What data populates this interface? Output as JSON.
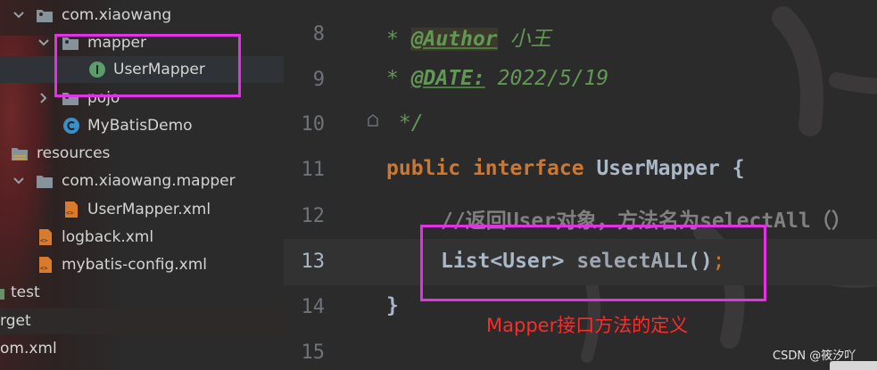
{
  "project_tree": {
    "items": [
      {
        "label": "com.xiaowang",
        "icon": "package-folder-icon",
        "expanded": true
      },
      {
        "label": "mapper",
        "icon": "package-folder-icon",
        "expanded": true
      },
      {
        "label": "UserMapper",
        "icon": "interface-icon",
        "selected": true
      },
      {
        "label": "pojo",
        "icon": "package-folder-icon",
        "expanded": false
      },
      {
        "label": "MyBatisDemo",
        "icon": "class-icon"
      },
      {
        "label": "resources",
        "icon": "resources-folder-icon"
      },
      {
        "label": "com.xiaowang.mapper",
        "icon": "folder-icon",
        "expanded": true
      },
      {
        "label": "UserMapper.xml",
        "icon": "xml-file-icon"
      },
      {
        "label": "logback.xml",
        "icon": "xml-file-icon"
      },
      {
        "label": "mybatis-config.xml",
        "icon": "xml-file-icon"
      },
      {
        "label": "test",
        "icon": "folder-icon"
      },
      {
        "label": "rget",
        "icon": "folder-icon"
      },
      {
        "label": "om.xml",
        "icon": "maven-file-icon"
      }
    ]
  },
  "editor": {
    "line_numbers": [
      "8",
      "9",
      "10",
      "11",
      "12",
      "13",
      "14",
      "15"
    ],
    "current_line": "13",
    "lines": {
      "l8": {
        "star": "* ",
        "tag": "@Author",
        "text": " 小王"
      },
      "l9": {
        "star": "* ",
        "tag": "@DATE:",
        "text": " 2022/5/19"
      },
      "l10": {
        "text": " */"
      },
      "l11": {
        "kw1": "public",
        "kw2": "interface",
        "name": "UserMapper",
        "brace": " {"
      },
      "l12": {
        "comment": "//返回User对象，方法名为selectAll（）"
      },
      "l13": {
        "type": "List<User>",
        "method": "selectALL",
        "parens": "()",
        "semi": ";"
      },
      "l14": {
        "brace": "}"
      }
    }
  },
  "annotation": {
    "text": "Mapper接口方法的定义",
    "color": "#ff2a2a",
    "box_color": "#e332e6"
  },
  "watermark": "CSDN @筱汐吖",
  "colors": {
    "keyword": "#cc7832",
    "doc_comment": "#629755",
    "comment": "#808080",
    "text": "#a9b7c6"
  }
}
